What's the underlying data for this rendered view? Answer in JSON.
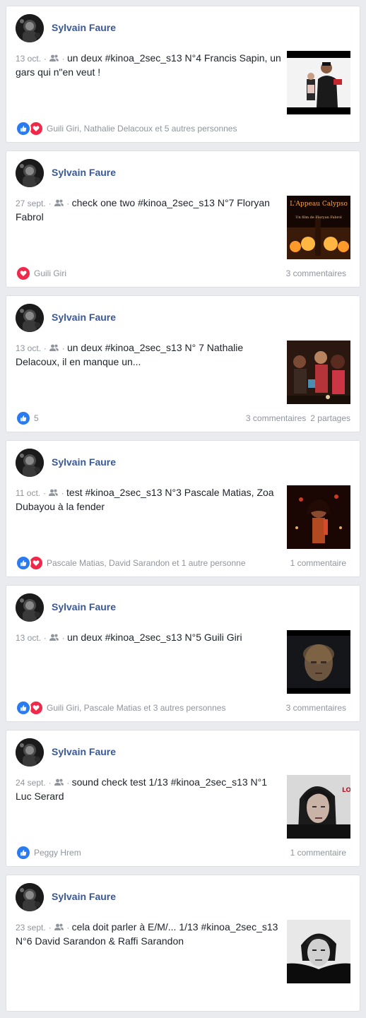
{
  "posts": [
    {
      "author": "Sylvain Faure",
      "date": "13 oct.",
      "text": "un deux #kinoa_2sec_s13 N°4 Francis Sapin, un gars qui n\"en veut !",
      "reactions": [
        "like",
        "love"
      ],
      "reaction_text": "Guili Giri, Nathalie Delacoux et 5 autres personnes",
      "comments": "",
      "shares": "",
      "thumb_theme": "studio"
    },
    {
      "author": "Sylvain Faure",
      "date": "27 sept.",
      "text": "check one two #kinoa_2sec_s13 N°7 Floryan Fabrol",
      "reactions": [
        "love"
      ],
      "reaction_text": "Guili Giri",
      "comments": "3 commentaires",
      "shares": "",
      "thumb_theme": "poster",
      "thumb_title": "L'Appeau Calypso",
      "thumb_sub": "Un film de Floryan Fabrol"
    },
    {
      "author": "Sylvain Faure",
      "date": "13 oct.",
      "text": "un deux #kinoa_2sec_s13 N° 7 Nathalie Delacoux, il en manque un...",
      "reactions": [
        "like"
      ],
      "reaction_text": "5",
      "comments": "3 commentaires",
      "shares": "2 partages",
      "thumb_theme": "party"
    },
    {
      "author": "Sylvain Faure",
      "date": "11 oct.",
      "text": "test #kinoa_2sec_s13 N°3 Pascale Matias, Zoa Dubayou à la fender",
      "reactions": [
        "like",
        "love"
      ],
      "reaction_text": "Pascale Matias, David Sarandon et 1 autre personne",
      "comments": "1 commentaire",
      "shares": "",
      "thumb_theme": "singer"
    },
    {
      "author": "Sylvain Faure",
      "date": "13 oct.",
      "text": "un deux #kinoa_2sec_s13 N°5 Guili Giri",
      "reactions": [
        "like",
        "love"
      ],
      "reaction_text": "Guili Giri, Pascale Matias et 3 autres personnes",
      "comments": "3 commentaires",
      "shares": "",
      "thumb_theme": "face-blur"
    },
    {
      "author": "Sylvain Faure",
      "date": "24 sept.",
      "text": "sound check test 1/13 #kinoa_2sec_s13 N°1 Luc Serard",
      "reactions": [
        "like"
      ],
      "reaction_text": "Peggy Hrem",
      "comments": "1 commentaire",
      "shares": "",
      "thumb_theme": "portrait",
      "thumb_title": "LO"
    },
    {
      "author": "Sylvain Faure",
      "date": "23 sept.",
      "text": "cela doit parler à E/M/... 1/13 #kinoa_2sec_s13 N°6 David Sarandon & Raffi Sarandon",
      "reactions": [],
      "reaction_text": "",
      "comments": "",
      "shares": "",
      "thumb_theme": "bw"
    }
  ],
  "colors": {
    "link": "#385898",
    "meta": "#90949c",
    "like": "#2b7bf0",
    "love": "#f0284a",
    "page_bg": "#e9ebee"
  },
  "icons": {
    "audience": "friends-icon",
    "like": "thumbs-up-icon",
    "love": "heart-icon"
  }
}
